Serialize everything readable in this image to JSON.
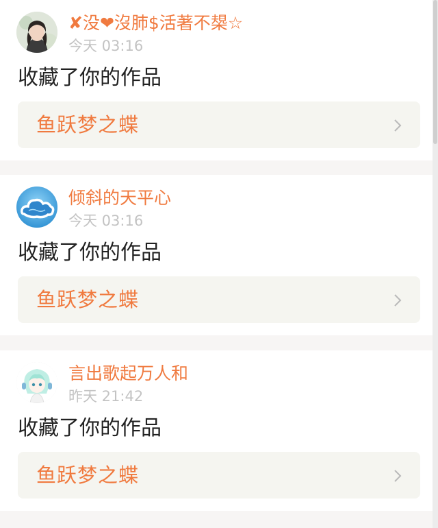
{
  "notifications": [
    {
      "username": "✘没❤沒肺$活著不槼☆",
      "time": "今天 03:16",
      "action": "收藏了你的作品",
      "work_title": "鱼跃梦之蝶",
      "avatar_icon": "user-photo-avatar"
    },
    {
      "username": "倾斜的天平心",
      "time": "今天 03:16",
      "action": "收藏了你的作品",
      "work_title": "鱼跃梦之蝶",
      "avatar_icon": "cloud-avatar"
    },
    {
      "username": "言出歌起万人和",
      "time": "昨天 21:42",
      "action": "收藏了你的作品",
      "work_title": "鱼跃梦之蝶",
      "avatar_icon": "anime-character-avatar"
    }
  ],
  "icons": {
    "chevron": "chevron-right-icon"
  },
  "colors": {
    "accent": "#f07a3f",
    "text": "#222222",
    "timestamp": "#c3c3c3",
    "link_background": "#f5f5f0",
    "page_background": "#f7f5f4"
  }
}
